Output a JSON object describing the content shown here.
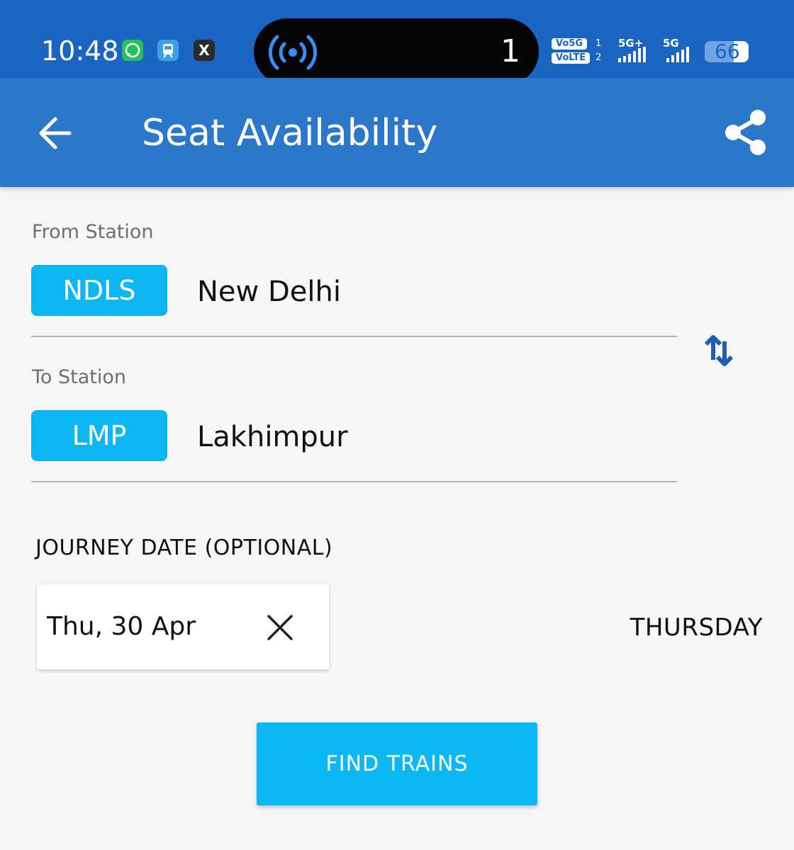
{
  "status_bar": {
    "time": "10:48",
    "notification_icons": [
      "whatsapp-icon",
      "train-app-icon",
      "x-icon"
    ],
    "x_glyph": "X",
    "island_count": "1",
    "sim1_label": "Vo5G",
    "sim1_num": "1",
    "sim2_label": "VoLTE",
    "sim2_num": "2",
    "net1_label": "5G+",
    "net2_label": "5G",
    "battery_level": "66",
    "colors": {
      "bar": "#1a64c2"
    }
  },
  "app_bar": {
    "title": "Seat Availability",
    "color": "#2b77c9"
  },
  "from": {
    "label": "From Station",
    "code": "NDLS",
    "name": "New Delhi"
  },
  "to": {
    "label": "To Station",
    "code": "LMP",
    "name": "Lakhimpur"
  },
  "journey": {
    "label": "JOURNEY DATE (OPTIONAL)",
    "date": "Thu, 30 Apr",
    "day": "THURSDAY"
  },
  "actions": {
    "find_label": "FIND TRAINS",
    "accent": "#0bb8f4"
  }
}
